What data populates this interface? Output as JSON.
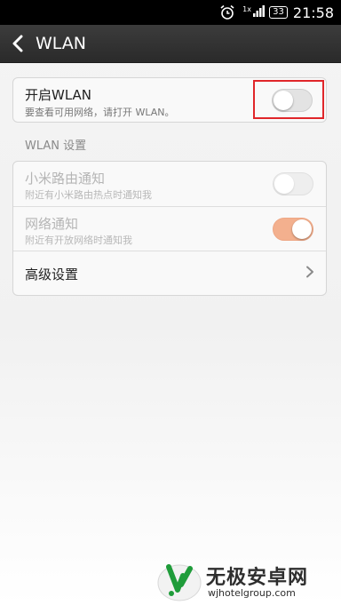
{
  "status_bar": {
    "time": "21:58",
    "battery": "33",
    "network_type": "1x",
    "icons": [
      "alarm-icon",
      "signal-icon"
    ]
  },
  "title_bar": {
    "back_icon": "chevron-left-icon",
    "title": "WLAN"
  },
  "wlan_toggle": {
    "title": "开启WLAN",
    "subtitle": "要查看可用网络，请打开 WLAN。",
    "enabled": false,
    "highlight_color": "#e0262a"
  },
  "settings": {
    "section_title": "WLAN 设置",
    "items": [
      {
        "title": "小米路由通知",
        "subtitle": "附近有小米路由热点时通知我",
        "toggle": false,
        "disabled": true
      },
      {
        "title": "网络通知",
        "subtitle": "附近有开放网络时通知我",
        "toggle": true,
        "disabled": true
      },
      {
        "title": "高级设置",
        "icon": "chevron-right-icon"
      }
    ]
  },
  "colors": {
    "toggle_on_disabled": "#f3b08e",
    "title_bar": "#333333"
  },
  "watermark": {
    "title": "无极安卓网",
    "url": "wjhotelgroup.com"
  }
}
